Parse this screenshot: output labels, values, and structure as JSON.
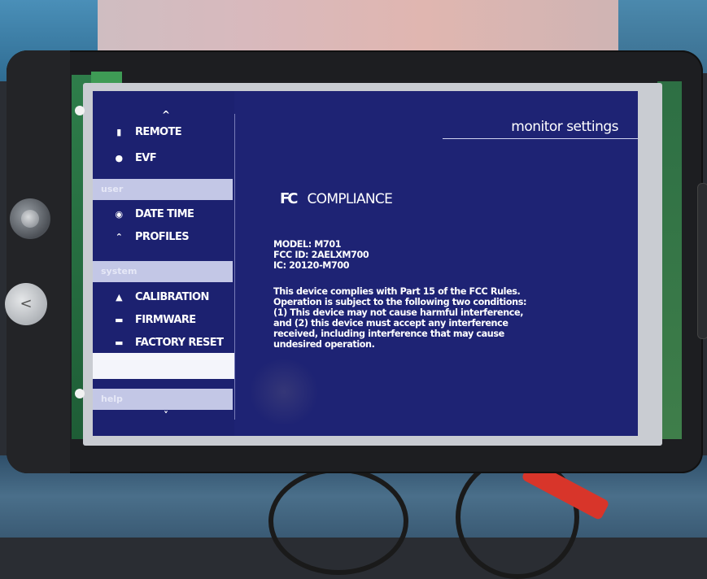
{
  "header": {
    "title": "monitor settings"
  },
  "sidebar": {
    "scroll_up_glyph": "^",
    "scroll_down_glyph": "˅",
    "group1_items": [
      {
        "label": "REMOTE",
        "icon": "remote-icon",
        "glyph": "▮"
      },
      {
        "label": "EVF",
        "icon": "evf-icon",
        "glyph": "●"
      }
    ],
    "section_user": "user",
    "group2_items": [
      {
        "label": "DATE TIME",
        "icon": "clock-icon",
        "glyph": "◉"
      },
      {
        "label": "PROFILES",
        "icon": "profiles-icon",
        "glyph": "⌃"
      }
    ],
    "section_system": "system",
    "group3_items": [
      {
        "label": "CALIBRATION",
        "icon": "calibration-icon",
        "glyph": "▲"
      },
      {
        "label": "FIRMWARE",
        "icon": "firmware-icon",
        "glyph": "▬"
      },
      {
        "label": "FACTORY RESET",
        "icon": "reset-icon",
        "glyph": "▬"
      }
    ],
    "selected_item": "",
    "section_help": "help"
  },
  "compliance": {
    "logo": "FC",
    "title": "COMPLIANCE",
    "model": "MODEL: M701",
    "fcc_id": "FCC ID: 2AELXM700",
    "ic": "IC: 20120-M700",
    "statement": "This device complies with Part 15 of the FCC Rules. Operation is subject to the following two conditions: (1) This device may not cause harmful interference, and (2) this device must accept any interference received, including interference that may cause undesired operation."
  },
  "device": {
    "back_button_glyph": "<"
  }
}
